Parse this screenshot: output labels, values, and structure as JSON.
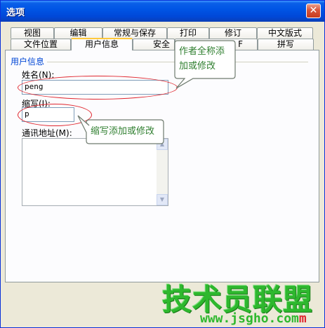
{
  "window": {
    "title": "选项",
    "close_glyph": "✕"
  },
  "tabs_row_back": [
    {
      "label": "视图"
    },
    {
      "label": "编辑"
    },
    {
      "label": "常规与保存"
    },
    {
      "label": "打印"
    },
    {
      "label": "修订"
    },
    {
      "label": "中文版式"
    }
  ],
  "tabs_row_front": [
    {
      "label": "文件位置"
    },
    {
      "label": "用户信息",
      "active": true
    },
    {
      "label": "安全"
    },
    {
      "label": "F"
    },
    {
      "label": "拼写"
    }
  ],
  "user_info": {
    "group_title": "用户信息",
    "name_label": "姓名(N):",
    "name_value": "peng",
    "initials_label": "缩写(I):",
    "initials_value": "p",
    "address_label": "通讯地址(M):",
    "address_value": ""
  },
  "annotations": {
    "callout_name": [
      "作者全称添",
      "加或修改"
    ],
    "callout_initials": "缩写添加或修改",
    "accent_color": "#E0262E",
    "callout_text_color": "#2F7F2F"
  },
  "watermark": {
    "brand": "技术员联盟",
    "url_main": "www.jsgho.com",
    "url_tail": "m"
  },
  "icons": {
    "close": "close-icon",
    "scroll_up": "scroll-up-arrow-icon",
    "scroll_down": "scroll-down-arrow-icon"
  }
}
